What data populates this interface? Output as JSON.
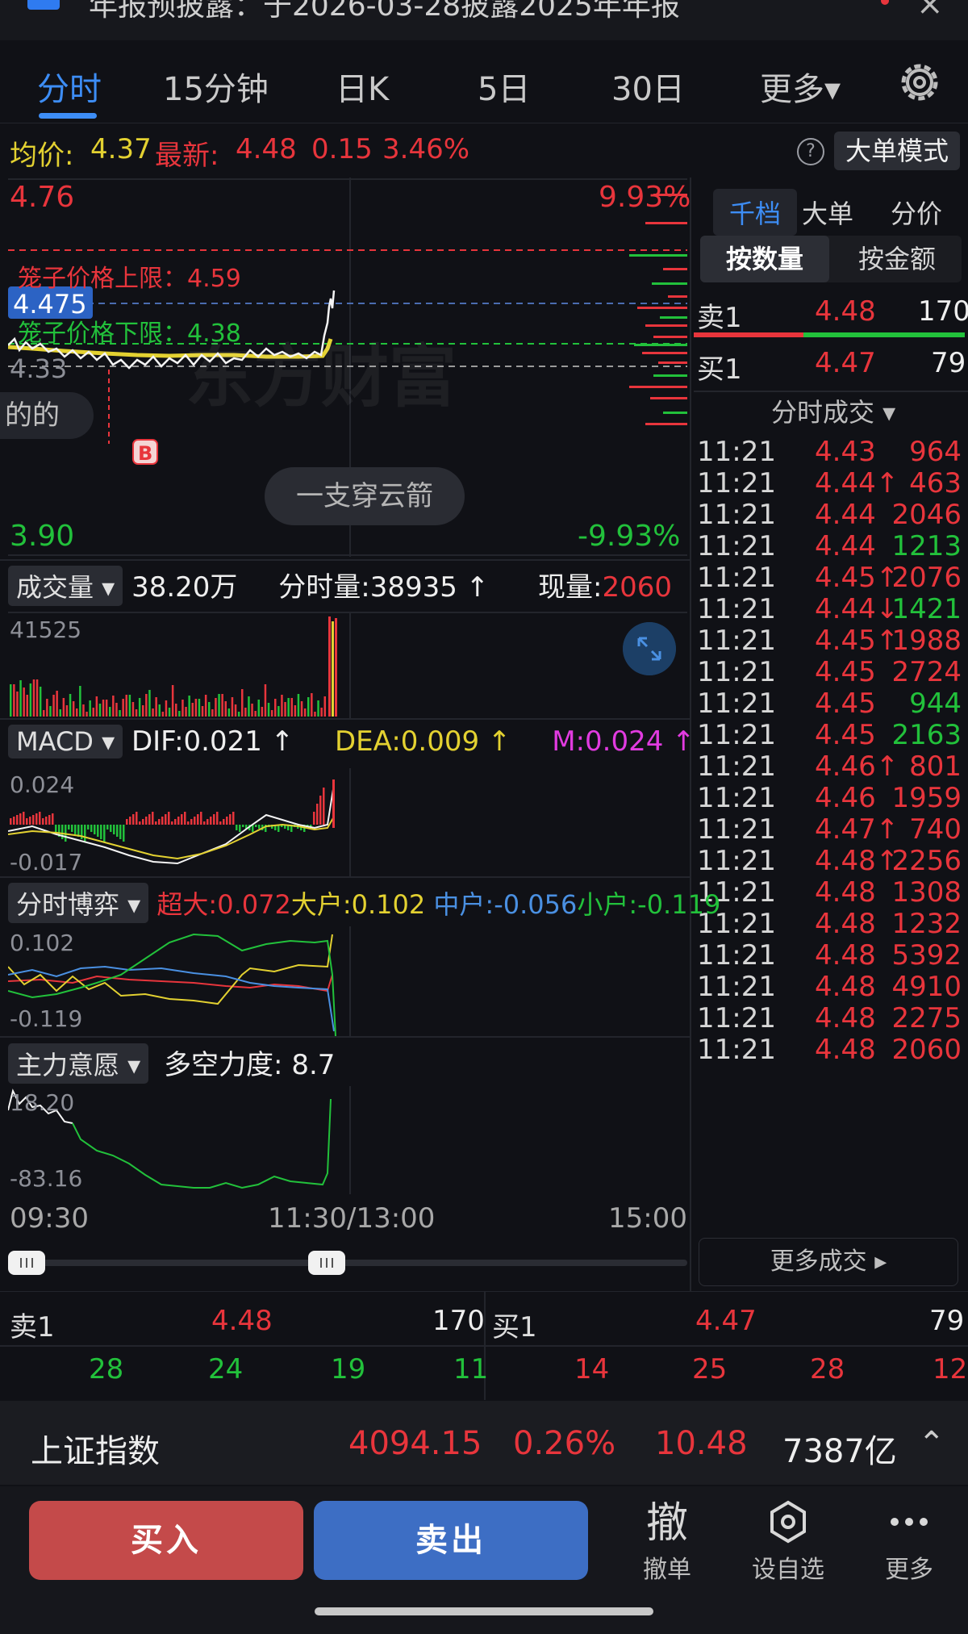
{
  "banner": {
    "text": "年报预披露：于2026-03-28披露2025年年报",
    "close": "×"
  },
  "tabs": [
    "分时",
    "15分钟",
    "日K",
    "5日",
    "30日",
    "更多▾"
  ],
  "price_bar": {
    "avg_label": "均价:",
    "avg_value": "4.37",
    "latest_label": "最新:",
    "latest_value": "4.48",
    "change": "0.15",
    "pct": "3.46%",
    "help": "?",
    "mode_button": "大单模式"
  },
  "main_chart": {
    "top_price": "4.76",
    "bottom_price": "3.90",
    "top_pct": "9.93%",
    "bottom_pct": "-9.93%",
    "upper_cage": "笼子价格上限：4.59",
    "lower_cage": "笼子价格下限：4.38",
    "cursor_price": "4.475",
    "y_ref": "4.33",
    "buy_marker": "B",
    "left_pill": "的的",
    "pattern_pill": "一支穿云箭",
    "watermark": "东方财富"
  },
  "right_panel": {
    "tabs": [
      "千档",
      "大单",
      "分价"
    ],
    "segments": [
      "按数量",
      "按金额"
    ],
    "ask": {
      "label": "卖1",
      "price": "4.48",
      "qty": "170"
    },
    "bid": {
      "label": "买1",
      "price": "4.47",
      "qty": "79"
    },
    "trades_title": "分时成交 ▾",
    "trades": [
      {
        "t": "11:21",
        "p": "4.43",
        "v": "964",
        "c": "red",
        "a": ""
      },
      {
        "t": "11:21",
        "p": "4.44↑",
        "v": "463",
        "c": "red",
        "a": ""
      },
      {
        "t": "11:21",
        "p": "4.44",
        "v": "2046",
        "c": "red",
        "a": ""
      },
      {
        "t": "11:21",
        "p": "4.44",
        "v": "1213",
        "c": "green",
        "a": ""
      },
      {
        "t": "11:21",
        "p": "4.45↑",
        "v": "2076",
        "c": "red",
        "a": ""
      },
      {
        "t": "11:21",
        "p": "4.44↓",
        "v": "1421",
        "c": "green",
        "a": ""
      },
      {
        "t": "11:21",
        "p": "4.45↑",
        "v": "1988",
        "c": "red",
        "a": ""
      },
      {
        "t": "11:21",
        "p": "4.45",
        "v": "2724",
        "c": "red",
        "a": ""
      },
      {
        "t": "11:21",
        "p": "4.45",
        "v": "944",
        "c": "green",
        "a": ""
      },
      {
        "t": "11:21",
        "p": "4.45",
        "v": "2163",
        "c": "green",
        "a": ""
      },
      {
        "t": "11:21",
        "p": "4.46↑",
        "v": "801",
        "c": "red",
        "a": ""
      },
      {
        "t": "11:21",
        "p": "4.46",
        "v": "1959",
        "c": "red",
        "a": ""
      },
      {
        "t": "11:21",
        "p": "4.47↑",
        "v": "740",
        "c": "red",
        "a": ""
      },
      {
        "t": "11:21",
        "p": "4.48↑",
        "v": "2256",
        "c": "red",
        "a": ""
      },
      {
        "t": "11:21",
        "p": "4.48",
        "v": "1308",
        "c": "red",
        "a": ""
      },
      {
        "t": "11:21",
        "p": "4.48",
        "v": "1232",
        "c": "red",
        "a": ""
      },
      {
        "t": "11:21",
        "p": "4.48",
        "v": "5392",
        "c": "red",
        "a": ""
      },
      {
        "t": "11:21",
        "p": "4.48",
        "v": "4910",
        "c": "red",
        "a": ""
      },
      {
        "t": "11:21",
        "p": "4.48",
        "v": "2275",
        "c": "red",
        "a": ""
      },
      {
        "t": "11:21",
        "p": "4.48",
        "v": "2060",
        "c": "red",
        "a": ""
      }
    ],
    "more_trades": "更多成交 ▸"
  },
  "volume_panel": {
    "dropdown": "成交量 ▾",
    "total": "38.20万",
    "min_vol_label": "分时量:",
    "min_vol": "38935",
    "cur_label": "现量:",
    "cur_value": "2060",
    "scale": "41525"
  },
  "macd_panel": {
    "dropdown": "MACD ▾",
    "dif": "DIF:0.021",
    "dea": "DEA:0.009",
    "m": "M:0.024",
    "top": "0.024",
    "bottom": "-0.017"
  },
  "flow_panel": {
    "dropdown": "分时博弈 ▾",
    "super": "超大:0.072",
    "large": "大户:0.102",
    "mid": "中户:-0.056",
    "small": "小户:-0.119",
    "top": "0.102",
    "bottom": "-0.119"
  },
  "will_panel": {
    "dropdown": "主力意愿 ▾",
    "strength": "多空力度: 8.7",
    "top": "18.20",
    "bottom": "-83.16"
  },
  "time_axis": [
    "09:30",
    "11:30/13:00",
    "15:00"
  ],
  "bottom_book": {
    "ask_label": "卖1",
    "ask_price": "4.48",
    "ask_qty": "170",
    "bid_label": "买1",
    "bid_price": "4.47",
    "bid_qty": "79",
    "ask_levels": [
      "28",
      "24",
      "19",
      "11"
    ],
    "bid_levels": [
      "14",
      "25",
      "28",
      "12"
    ]
  },
  "index_bar": {
    "name": "上证指数",
    "value": "4094.15",
    "pct": "0.26%",
    "change": "10.48",
    "amount": "7387亿",
    "expand": "⌃"
  },
  "actions": {
    "buy": "买入",
    "sell": "卖出",
    "cancel_icon": "撤",
    "cancel": "撤单",
    "watch": "设自选",
    "more": "更多"
  },
  "colors": {
    "up": "#e8353c",
    "down": "#22c13b",
    "accent": "#3d8df5",
    "avg_line": "#e3d131"
  },
  "chart_data": {
    "type": "line",
    "x": [
      "09:30",
      "11:30/13:00",
      "15:00"
    ],
    "ylim": [
      3.9,
      4.76
    ],
    "series": []
  }
}
